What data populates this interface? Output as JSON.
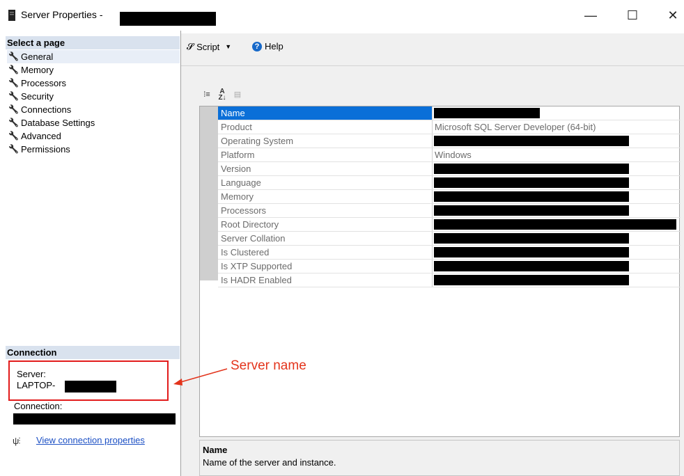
{
  "window": {
    "title": "Server Properties -",
    "minimize_glyph": "—",
    "maximize_glyph": "☐",
    "close_glyph": "✕"
  },
  "left_pane": {
    "select_page_header": "Select a page",
    "pages": [
      {
        "label": "General",
        "selected": true
      },
      {
        "label": "Memory",
        "selected": false
      },
      {
        "label": "Processors",
        "selected": false
      },
      {
        "label": "Security",
        "selected": false
      },
      {
        "label": "Connections",
        "selected": false
      },
      {
        "label": "Database Settings",
        "selected": false
      },
      {
        "label": "Advanced",
        "selected": false
      },
      {
        "label": "Permissions",
        "selected": false
      }
    ],
    "connection_header": "Connection",
    "server_label": "Server:",
    "server_value": "LAPTOP-",
    "connection_label": "Connection:",
    "view_connection_properties": "View connection properties"
  },
  "toolbar": {
    "script_label": "Script",
    "help_label": "Help",
    "help_icon_glyph": "?"
  },
  "grid": {
    "rows": [
      {
        "name": "Name",
        "value": "",
        "redacted": true
      },
      {
        "name": "Product",
        "value": "Microsoft SQL Server Developer (64-bit)",
        "redacted": false
      },
      {
        "name": "Operating System",
        "value": "",
        "redacted": true
      },
      {
        "name": "Platform",
        "value": "Windows",
        "redacted": false
      },
      {
        "name": "Version",
        "value": "",
        "redacted": true
      },
      {
        "name": "Language",
        "value": "",
        "redacted": true
      },
      {
        "name": "Memory",
        "value": "",
        "redacted": true
      },
      {
        "name": "Processors",
        "value": "",
        "redacted": true
      },
      {
        "name": "Root Directory",
        "value": "",
        "redacted": true
      },
      {
        "name": "Server Collation",
        "value": "",
        "redacted": true
      },
      {
        "name": "Is Clustered",
        "value": "",
        "redacted": true
      },
      {
        "name": "Is XTP Supported",
        "value": "",
        "redacted": true
      },
      {
        "name": "Is HADR Enabled",
        "value": "",
        "redacted": true
      }
    ],
    "selected_row": "Name"
  },
  "description": {
    "title": "Name",
    "text": "Name of the server and instance."
  },
  "annotation": {
    "text": "Server name",
    "color": "#e3341c"
  },
  "colors": {
    "selection": "#0a6fd8",
    "section_header": "#d9e2ee",
    "highlight_box": "#e21b1b",
    "link": "#1b4fc4"
  }
}
